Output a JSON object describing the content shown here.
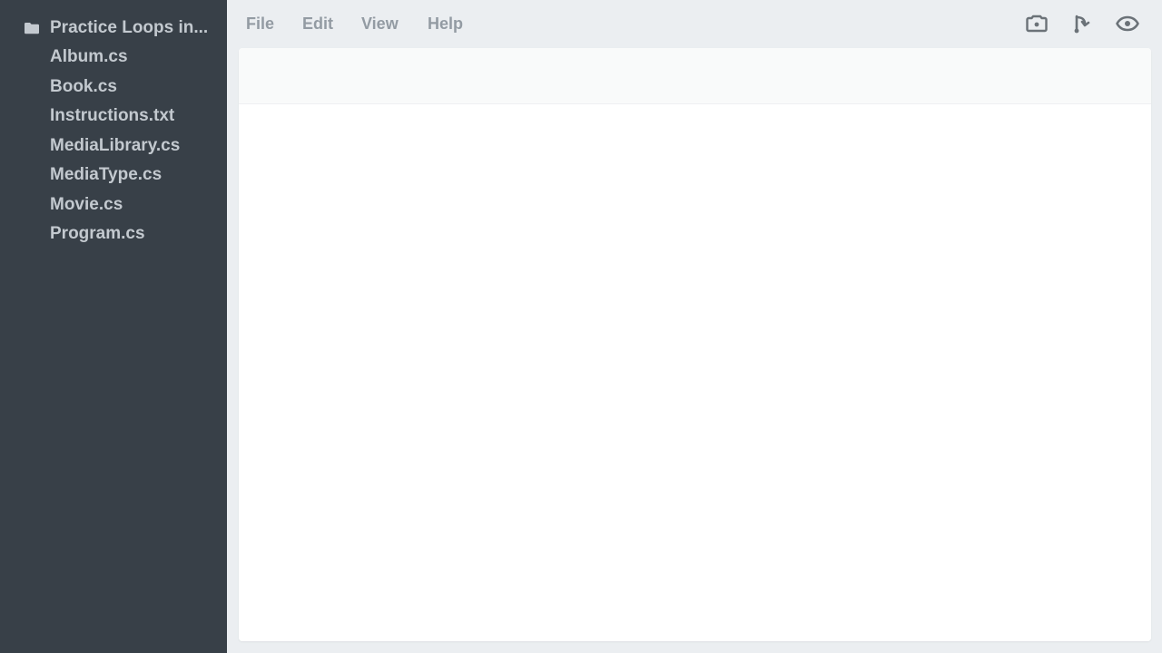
{
  "sidebar": {
    "folder": {
      "label": "Practice Loops in...",
      "icon": "folder-icon"
    },
    "files": [
      {
        "label": "Album.cs"
      },
      {
        "label": "Book.cs"
      },
      {
        "label": "Instructions.txt"
      },
      {
        "label": "MediaLibrary.cs"
      },
      {
        "label": "MediaType.cs"
      },
      {
        "label": "Movie.cs"
      },
      {
        "label": "Program.cs"
      }
    ]
  },
  "menubar": {
    "file": "File",
    "edit": "Edit",
    "view": "View",
    "help": "Help",
    "tools": [
      "camera-icon",
      "fork-icon",
      "eye-icon"
    ]
  },
  "colors": {
    "sidebar_bg": "#384048",
    "sidebar_text": "#c3c9cf",
    "menu_text": "#939ba3",
    "icon": "#6b7278",
    "app_bg": "#ebeef1",
    "editor_bg": "#ffffff"
  }
}
